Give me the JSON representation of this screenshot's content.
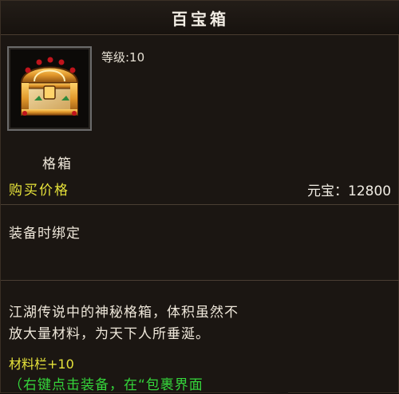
{
  "tooltip": {
    "title": "百宝箱",
    "level": "等级:10",
    "item_icon": "treasure-chest-icon",
    "item_name": "格箱",
    "price_label": "购买价格",
    "price_value": "元宝：12800",
    "binding": "装备时绑定",
    "description_line1": "江湖传说中的神秘格箱，体积虽然不",
    "description_line2": "放大量材料，为天下人所垂涎。",
    "bonus": "材料栏+10",
    "usage_hint": "（右键点击装备，在“包裹界面"
  },
  "colors": {
    "background": "#1b1612",
    "accent_yellow": "#e6e23a",
    "accent_green": "#35d53b",
    "text": "#eee7da"
  }
}
